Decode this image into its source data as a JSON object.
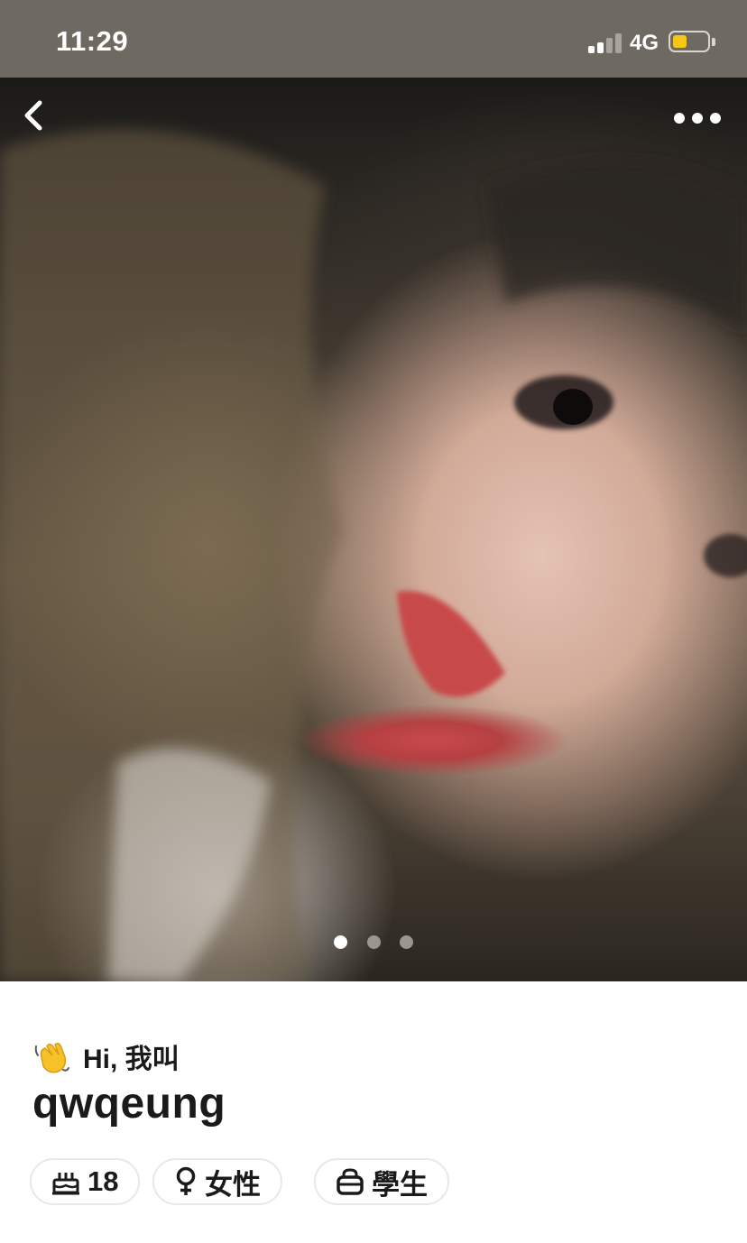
{
  "status_bar": {
    "time": "11:29",
    "network": "4G",
    "battery_level": 0.4,
    "battery_color": "#f5c518"
  },
  "nav": {
    "back_icon": "chevron-left-icon",
    "more_icon": "more-horizontal-icon"
  },
  "photo": {
    "description_icon": "profile-photo",
    "current_index": 1,
    "total": 3
  },
  "profile": {
    "greeting": "Hi, 我叫",
    "greeting_icon": "waving-hand-icon",
    "username": "qwqeung",
    "tags": [
      {
        "icon": "birthday-cake-icon",
        "label": "18"
      },
      {
        "icon": "female-icon",
        "label": "女性"
      },
      {
        "icon": "bag-icon",
        "label": "學生"
      }
    ]
  }
}
